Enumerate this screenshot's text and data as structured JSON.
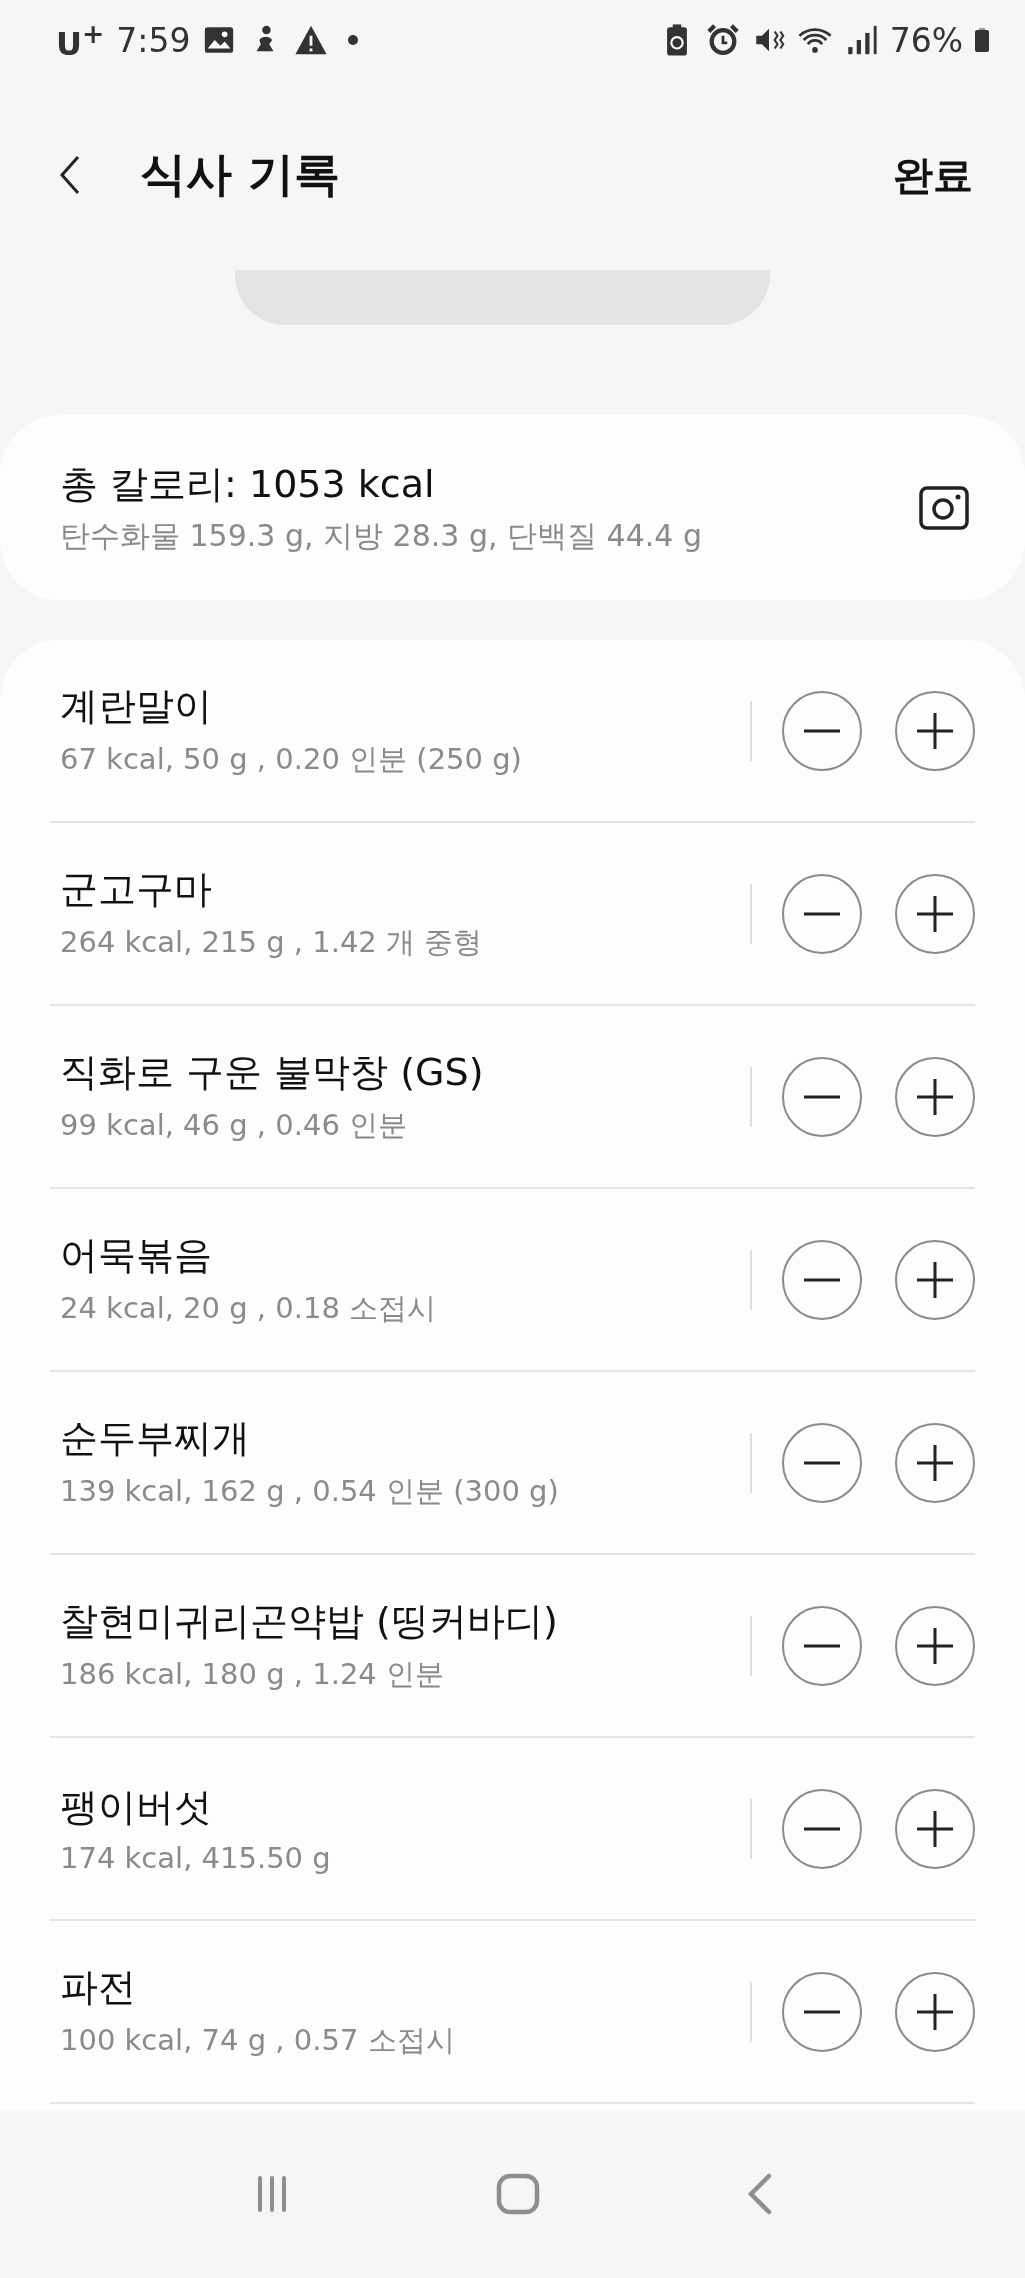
{
  "status_bar": {
    "carrier": "U$^{+}$",
    "time": "7:59",
    "battery": "76%"
  },
  "header": {
    "title": "식사 기록",
    "done": "완료"
  },
  "summary": {
    "total": "총 칼로리: 1053 kcal",
    "macros": "탄수화물 159.3 g, 지방 28.3 g, 단백질 44.4 g"
  },
  "foods": [
    {
      "name": "계란말이",
      "detail": "67 kcal, 50 g , 0.20 인분 (250 g)"
    },
    {
      "name": "군고구마",
      "detail": "264 kcal, 215 g , 1.42 개 중형"
    },
    {
      "name": "직화로 구운 불막창 (GS)",
      "detail": "99 kcal, 46 g , 0.46 인분"
    },
    {
      "name": "어묵볶음",
      "detail": "24 kcal, 20 g , 0.18 소접시"
    },
    {
      "name": "순두부찌개",
      "detail": "139 kcal, 162 g , 0.54 인분 (300 g)"
    },
    {
      "name": "찰현미귀리곤약밥 (띵커바디)",
      "detail": "186 kcal, 180 g , 1.24 인분"
    },
    {
      "name": "팽이버섯",
      "detail": "174 kcal, 415.50 g"
    },
    {
      "name": "파전",
      "detail": "100 kcal, 74 g , 0.57 소접시"
    }
  ]
}
